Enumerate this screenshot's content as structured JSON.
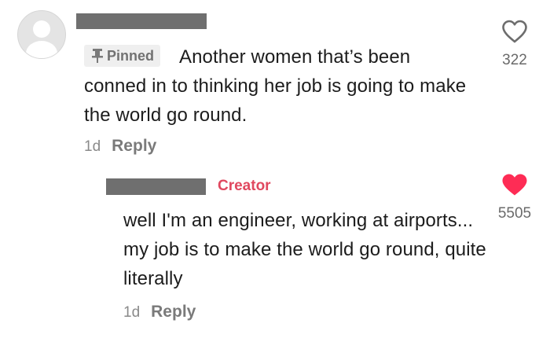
{
  "comment": {
    "pinned_label": "Pinned",
    "text_first_line": "Another women that’s been",
    "text_rest": "conned in to thinking her job is going to make the world go round.",
    "timestamp": "1d",
    "reply_label": "Reply",
    "likes": "322",
    "liked": false,
    "icons": {
      "avatar": "default-avatar-icon",
      "pin": "pin-icon",
      "like": "heart-outline-icon"
    }
  },
  "reply": {
    "badge": "Creator",
    "text": "well I'm an engineer, working at airports... my job is to make the world go round, quite literally",
    "timestamp": "1d",
    "reply_label": "Reply",
    "likes": "5505",
    "liked": true,
    "icons": {
      "like": "heart-filled-icon"
    }
  },
  "colors": {
    "creator_badge": "#e0485f",
    "liked_heart": "#fe2c55",
    "redaction_bar": "#6f6f6f",
    "pinned_badge_bg": "#efefef"
  }
}
